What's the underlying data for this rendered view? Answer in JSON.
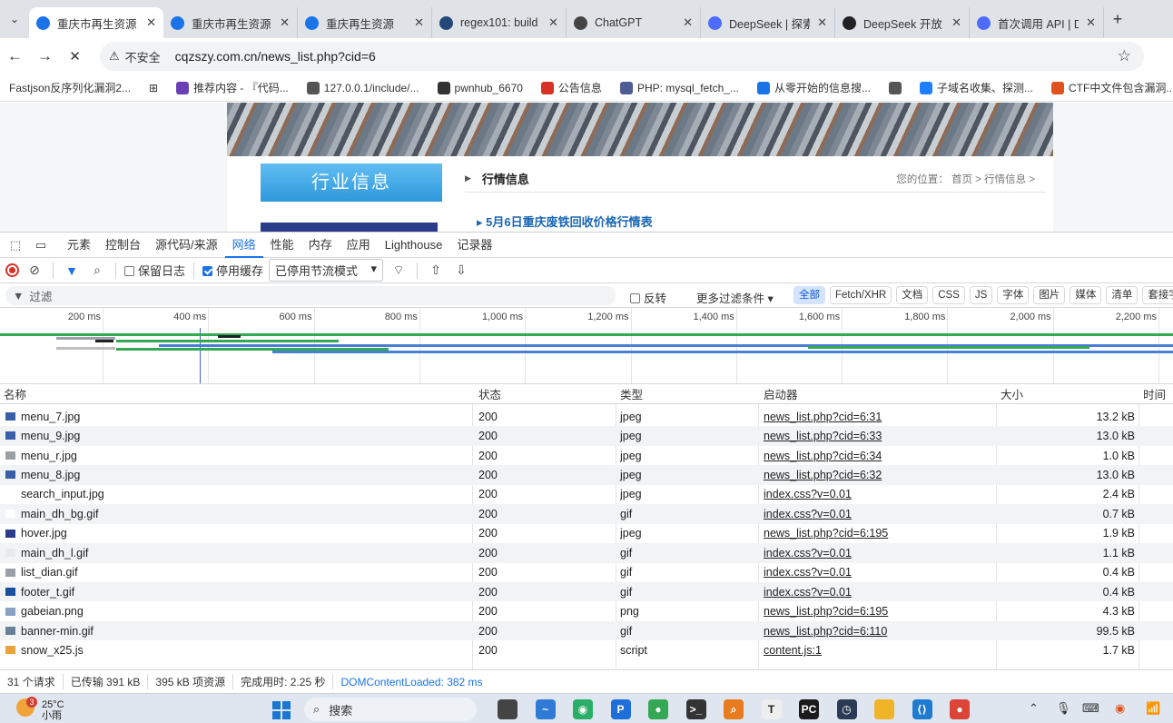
{
  "browser": {
    "tabs": [
      {
        "label": "重庆市再生资源",
        "icon": "loading-icon",
        "color": "#1a73e8",
        "active": true
      },
      {
        "label": "重庆市再生资源",
        "icon": "globe-icon",
        "color": "#1a73e8"
      },
      {
        "label": "重庆再生资源",
        "icon": "globe-icon",
        "color": "#1a73e8"
      },
      {
        "label": "regex101: build",
        "icon": "regex101-icon",
        "color": "#24487a"
      },
      {
        "label": "ChatGPT",
        "icon": "chatgpt-icon",
        "color": "#444444"
      },
      {
        "label": "DeepSeek | 探索",
        "icon": "deepseek-icon",
        "color": "#4d6bfe"
      },
      {
        "label": "DeepSeek 开放",
        "icon": "github-icon",
        "color": "#222222"
      },
      {
        "label": "首次调用 API | D",
        "icon": "deepseek-icon",
        "color": "#4d6bfe"
      }
    ],
    "insecure_label": "不安全",
    "url": "cqzszy.com.cn/news_list.php?cid=6",
    "bookmarks": [
      {
        "label": "Fastjson反序列化漏洞2...",
        "color": ""
      },
      {
        "label": "",
        "icon": "apps-grid-icon",
        "color": ""
      },
      {
        "label": "推荐内容 - 『代码...",
        "color": "#6a3fb5"
      },
      {
        "label": "127.0.0.1/include/...",
        "color": "#555555"
      },
      {
        "label": "pwnhub_6670",
        "color": "#333333"
      },
      {
        "label": "公告信息",
        "color": "#d93025"
      },
      {
        "label": "PHP: mysql_fetch_...",
        "color": "#4f5b93"
      },
      {
        "label": "从零开始的信息搜...",
        "color": "#1a73e8"
      },
      {
        "label": "",
        "icon": "globe-icon",
        "color": "#555555"
      },
      {
        "label": "子域名收集、探测...",
        "color": "#1e80ff"
      },
      {
        "label": "CTF中文件包含漏洞...",
        "color": "#e0521d"
      }
    ]
  },
  "site": {
    "sidebar_title": "行业信息",
    "section_title": "行情信息",
    "breadcrumb": "您的位置： 首页 > 行情信息 >",
    "news_item": "5月6日重庆废铁回收价格行情表"
  },
  "devtools": {
    "panels": [
      "元素",
      "控制台",
      "源代码/来源",
      "网络",
      "性能",
      "内存",
      "应用",
      "Lighthouse",
      "记录器"
    ],
    "active_panel": "网络",
    "preserve_log": "保留日志",
    "disable_cache": "停用缓存",
    "throttle": "已停用节流模式",
    "filter_placeholder": "过滤",
    "invert": "反转",
    "more_filters": "更多过滤条件",
    "type_chips": [
      "全部",
      "Fetch/XHR",
      "文档",
      "CSS",
      "JS",
      "字体",
      "图片",
      "媒体",
      "清单",
      "套接字"
    ],
    "timeline_ticks": [
      "200 ms",
      "400 ms",
      "600 ms",
      "800 ms",
      "1,000 ms",
      "1,200 ms",
      "1,400 ms",
      "1,600 ms",
      "1,800 ms",
      "2,000 ms",
      "2,200 ms"
    ],
    "columns": {
      "name": "名称",
      "status": "状态",
      "type": "类型",
      "initiator": "启动器",
      "size": "大小",
      "time": "时间"
    },
    "rows": [
      {
        "name": "menu_7.jpg",
        "status": "200",
        "type": "jpeg",
        "initiator": "news_list.php?cid=6:31",
        "size": "13.2 kB",
        "icon_color": "#3b5ea8"
      },
      {
        "name": "menu_9.jpg",
        "status": "200",
        "type": "jpeg",
        "initiator": "news_list.php?cid=6:33",
        "size": "13.0 kB",
        "icon_color": "#3b5ea8"
      },
      {
        "name": "menu_r.jpg",
        "status": "200",
        "type": "jpeg",
        "initiator": "news_list.php?cid=6:34",
        "size": "1.0 kB",
        "icon_color": "#9aa0a6"
      },
      {
        "name": "menu_8.jpg",
        "status": "200",
        "type": "jpeg",
        "initiator": "news_list.php?cid=6:32",
        "size": "13.0 kB",
        "icon_color": "#3b5ea8"
      },
      {
        "name": "search_input.jpg",
        "status": "200",
        "type": "jpeg",
        "initiator": "index.css?v=0.01",
        "size": "2.4 kB",
        "icon_color": "#ffffff"
      },
      {
        "name": "main_dh_bg.gif",
        "status": "200",
        "type": "gif",
        "initiator": "index.css?v=0.01",
        "size": "0.7 kB",
        "icon_color": "#ffffff"
      },
      {
        "name": "hover.jpg",
        "status": "200",
        "type": "jpeg",
        "initiator": "news_list.php?cid=6:195",
        "size": "1.9 kB",
        "icon_color": "#2a3c8a"
      },
      {
        "name": "main_dh_l.gif",
        "status": "200",
        "type": "gif",
        "initiator": "index.css?v=0.01",
        "size": "1.1 kB",
        "icon_color": "#e8eaed"
      },
      {
        "name": "list_dian.gif",
        "status": "200",
        "type": "gif",
        "initiator": "index.css?v=0.01",
        "size": "0.4 kB",
        "icon_color": "#9aa0a6"
      },
      {
        "name": "footer_t.gif",
        "status": "200",
        "type": "gif",
        "initiator": "index.css?v=0.01",
        "size": "0.4 kB",
        "icon_color": "#1a4fa0"
      },
      {
        "name": "gabeian.png",
        "status": "200",
        "type": "png",
        "initiator": "news_list.php?cid=6:195",
        "size": "4.3 kB",
        "icon_color": "#8aa1c2"
      },
      {
        "name": "banner-min.gif",
        "status": "200",
        "type": "gif",
        "initiator": "news_list.php?cid=6:110",
        "size": "99.5 kB",
        "icon_color": "#6c7f99"
      },
      {
        "name": "snow_x25.js",
        "status": "200",
        "type": "script",
        "initiator": "content.js:1",
        "size": "1.7 kB",
        "icon_color": "#e8a33d"
      }
    ],
    "summary": {
      "requests": "31 个请求",
      "transferred": "已传输 391 kB",
      "resources": "395 kB 项资源",
      "finish": "完成用时: 2.25 秒",
      "dcl": "DOMContentLoaded: 382 ms"
    }
  },
  "taskbar": {
    "weather_temp": "25°C",
    "weather_desc": "小雨",
    "weather_badge": "3",
    "search": "搜索",
    "apps": [
      {
        "icon": "file-explorer-dark-icon",
        "color": "#444444",
        "glyph": ""
      },
      {
        "icon": "photos-icon",
        "color": "#2f7bd6",
        "glyph": "~"
      },
      {
        "icon": "wechat-icon",
        "color": "#2aae67",
        "glyph": "◉"
      },
      {
        "icon": "p-app-icon",
        "color": "#1e6fd9",
        "glyph": "P"
      },
      {
        "icon": "chrome-icon-2",
        "color": "#34a853",
        "glyph": "●"
      },
      {
        "icon": "terminal-icon",
        "color": "#333333",
        "glyph": ">_"
      },
      {
        "icon": "search-tool-icon",
        "color": "#e87b1e",
        "glyph": "⌕"
      },
      {
        "icon": "typora-icon",
        "color": "#eeeeee",
        "glyph": "T"
      },
      {
        "icon": "pycharm-icon",
        "color": "#1b1b1b",
        "glyph": "PC"
      },
      {
        "icon": "clock-app-icon",
        "color": "#2b3a55",
        "glyph": "◷"
      },
      {
        "icon": "folder-icon",
        "color": "#f0b429",
        "glyph": ""
      },
      {
        "icon": "vscode-icon",
        "color": "#1f7ad1",
        "glyph": "⟨⟩"
      },
      {
        "icon": "chrome-icon",
        "color": "#db4437",
        "glyph": "●"
      }
    ]
  }
}
